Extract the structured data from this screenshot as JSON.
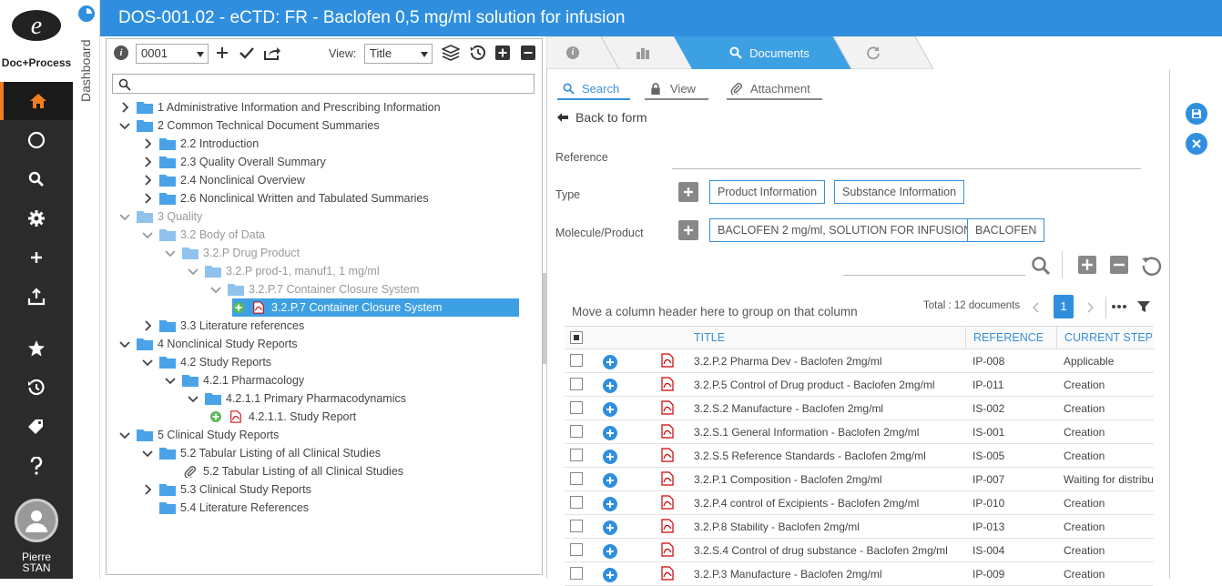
{
  "app": {
    "logo_letter": "e",
    "brand": "Doc+Process",
    "title": "DOS-001.02 - eCTD: FR - Baclofen 0,5 mg/ml solution for infusion",
    "dashboard_label": "Dashboard",
    "user": {
      "first": "Pierre",
      "last": "STAN"
    }
  },
  "nav": {
    "items": [
      "home-icon",
      "compass-icon",
      "search-icon",
      "gear-icon",
      "plus-icon",
      "upload-icon",
      "star-icon",
      "history-icon",
      "tags-icon",
      "help-icon"
    ],
    "active": "home-icon",
    "accent": "#f07d1e"
  },
  "toolbar": {
    "sequence": "0001",
    "view_label": "View:",
    "view_value": "Title"
  },
  "tree": [
    {
      "label": "1 Administrative Information and Prescribing Information",
      "level": 0,
      "state": "collapsed",
      "style": "normal"
    },
    {
      "label": "2 Common Technical Document Summaries",
      "level": 0,
      "state": "expanded",
      "style": "normal"
    },
    {
      "label": "2.2 Introduction",
      "level": 1,
      "state": "collapsed",
      "style": "normal"
    },
    {
      "label": "2.3 Quality Overall Summary",
      "level": 1,
      "state": "collapsed",
      "style": "normal"
    },
    {
      "label": "2.4 Nonclinical Overview",
      "level": 1,
      "state": "collapsed",
      "style": "normal"
    },
    {
      "label": "2.6 Nonclinical Written and Tabulated Summaries",
      "level": 1,
      "state": "collapsed",
      "style": "normal"
    },
    {
      "label": "3 Quality",
      "level": 0,
      "state": "expanded",
      "style": "gray"
    },
    {
      "label": "3.2 Body of Data",
      "level": 1,
      "state": "expanded",
      "style": "gray"
    },
    {
      "label": "3.2.P Drug Product",
      "level": 2,
      "state": "expanded",
      "style": "gray"
    },
    {
      "label": "3.2.P prod-1, manuf1, 1 mg/ml",
      "level": 3,
      "state": "expanded",
      "style": "gray"
    },
    {
      "label": "3.2.P.7 Container Closure System",
      "level": 4,
      "state": "expanded",
      "style": "gray"
    },
    {
      "label": "3.2.P.7 Container Closure System",
      "level": 5,
      "state": "doc",
      "style": "selected"
    },
    {
      "label": "3.3 Literature references",
      "level": 1,
      "state": "collapsed",
      "style": "normal"
    },
    {
      "label": "4 Nonclinical Study Reports",
      "level": 0,
      "state": "expanded",
      "style": "normal"
    },
    {
      "label": "4.2 Study Reports",
      "level": 1,
      "state": "expanded",
      "style": "normal"
    },
    {
      "label": "4.2.1 Pharmacology",
      "level": 2,
      "state": "expanded",
      "style": "normal"
    },
    {
      "label": "4.2.1.1 Primary Pharmacodynamics",
      "level": 3,
      "state": "expanded",
      "style": "normal"
    },
    {
      "label": "4.2.1.1. Study Report",
      "level": 4,
      "state": "doc",
      "style": "normal"
    },
    {
      "label": "5 Clinical Study Reports",
      "level": 0,
      "state": "expanded",
      "style": "normal"
    },
    {
      "label": "5.2 Tabular Listing of all Clinical Studies",
      "level": 1,
      "state": "expanded",
      "style": "normal"
    },
    {
      "label": "5.2 Tabular Listing of all Clinical Studies",
      "level": 2,
      "state": "attachment",
      "style": "normal"
    },
    {
      "label": "5.3 Clinical Study Reports",
      "level": 1,
      "state": "collapsed",
      "style": "normal"
    },
    {
      "label": "5.4 Literature References",
      "level": 1,
      "state": "leaf",
      "style": "normal"
    }
  ],
  "right": {
    "tabs": {
      "documents": "Documents"
    },
    "subtabs": [
      "Search",
      "View",
      "Attachment"
    ],
    "back": "Back to form",
    "form": {
      "reference_label": "Reference",
      "type_label": "Type",
      "type_chips": [
        "Product Information",
        "Substance Information"
      ],
      "molecule_label": "Molecule/Product",
      "molecule_chips": [
        "BACLOFEN 2 mg/ml, SOLUTION FOR INFUSION",
        "BACLOFEN"
      ]
    },
    "grid": {
      "group_hint": "Move a column header here to group on that column",
      "total": "Total : 12 documents",
      "page": "1",
      "columns": [
        "TITLE",
        "REFERENCE",
        "CURRENT STEP"
      ],
      "rows": [
        {
          "title": "3.2.P.2 Pharma Dev - Baclofen 2mg/ml",
          "ref": "IP-008",
          "step": "Applicable"
        },
        {
          "title": "3.2.P.5 Control of Drug product - Baclofen 2mg/ml",
          "ref": "IP-011",
          "step": "Creation"
        },
        {
          "title": "3.2.S.2 Manufacture - Baclofen 2mg/ml",
          "ref": "IS-002",
          "step": "Creation"
        },
        {
          "title": "3.2.S.1 General Information - Baclofen 2mg/ml",
          "ref": "IS-001",
          "step": "Creation"
        },
        {
          "title": "3.2.S.5 Reference Standards - Baclofen 2mg/ml",
          "ref": "IS-005",
          "step": "Creation"
        },
        {
          "title": "3.2.P.1 Composition - Baclofen 2mg/ml",
          "ref": "IP-007",
          "step": "Waiting for distribu"
        },
        {
          "title": "3.2.P.4 control of Excipients - Baclofen 2mg/ml",
          "ref": "IP-010",
          "step": "Creation"
        },
        {
          "title": "3.2.P.8 Stability - Baclofen 2mg/ml",
          "ref": "IP-013",
          "step": "Creation"
        },
        {
          "title": "3.2.S.4 Control of drug substance - Baclofen 2mg/ml",
          "ref": "IS-004",
          "step": "Creation"
        },
        {
          "title": "3.2.P.3 Manufacture - Baclofen 2mg/ml",
          "ref": "IP-009",
          "step": "Creation"
        }
      ]
    }
  },
  "colors": {
    "header": "#2f8fde",
    "accent": "#3a8fd8",
    "selected": "#3da0e3",
    "folder": "#4aa3e8"
  }
}
